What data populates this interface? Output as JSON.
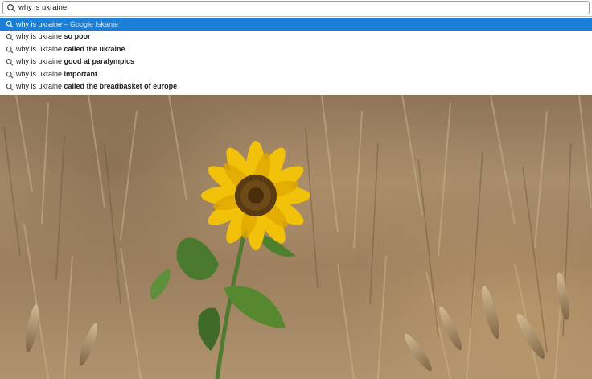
{
  "search": {
    "query": "why is ukraine",
    "icon": "search-icon"
  },
  "suggestions": [
    {
      "prefix": "why is ukraine",
      "completion": "",
      "engine": " – Google Iskanje",
      "selected": true
    },
    {
      "prefix": "why is ukraine ",
      "completion": "so poor",
      "engine": "",
      "selected": false
    },
    {
      "prefix": "why is ukraine ",
      "completion": "called the ukraine",
      "engine": "",
      "selected": false
    },
    {
      "prefix": "why is ukraine ",
      "completion": "good at paralympics",
      "engine": "",
      "selected": false
    },
    {
      "prefix": "why is ukraine ",
      "completion": "important",
      "engine": "",
      "selected": false
    },
    {
      "prefix": "why is ukraine ",
      "completion": "called the breadbasket of europe",
      "engine": "",
      "selected": false
    }
  ],
  "colors": {
    "selection": "#1a7fd6",
    "text": "#222222"
  }
}
